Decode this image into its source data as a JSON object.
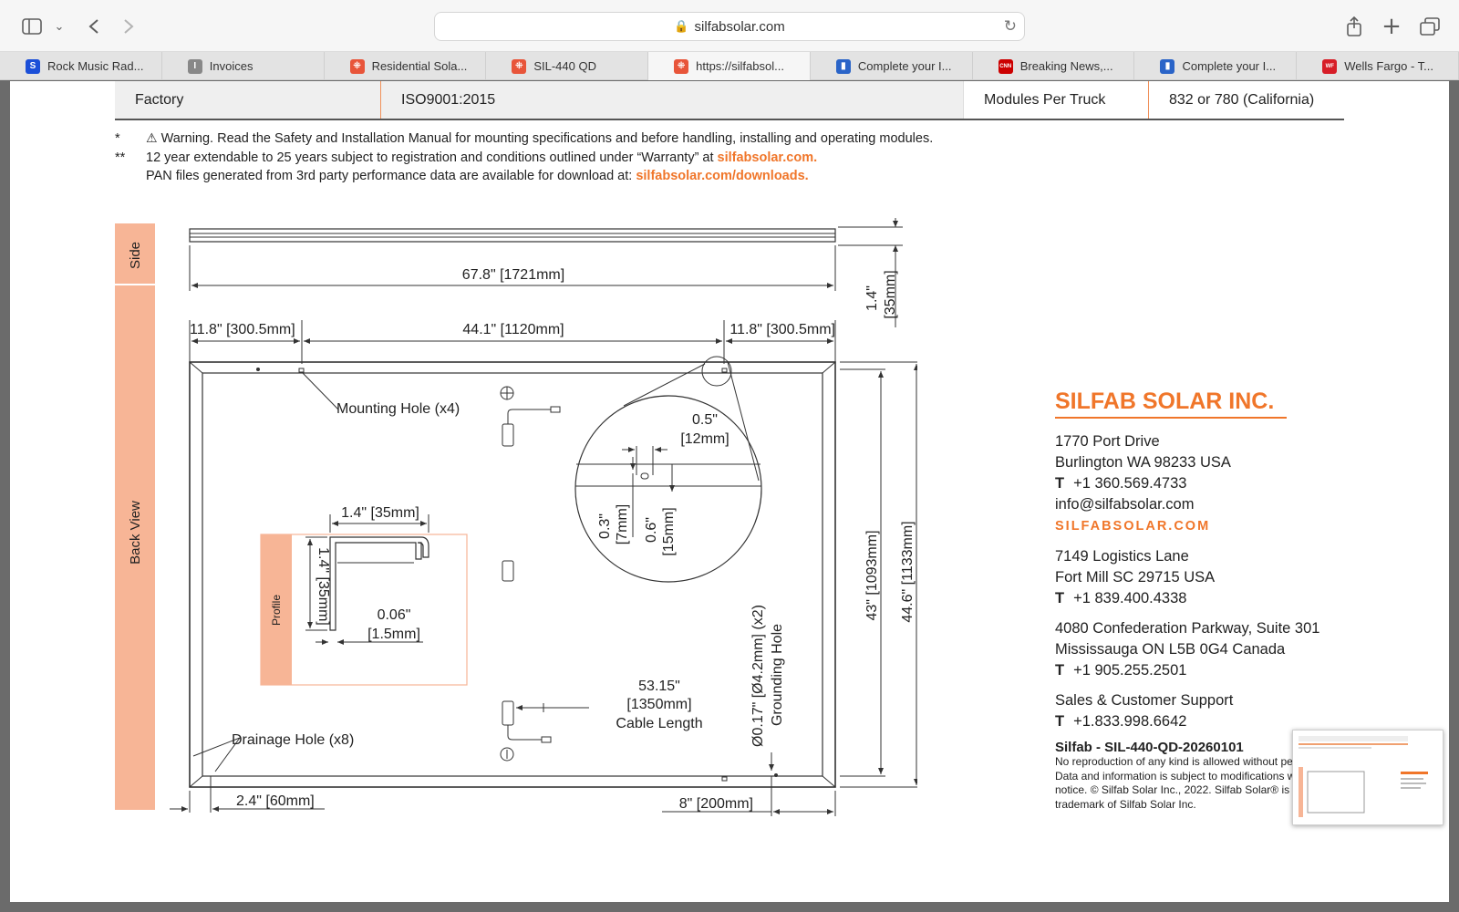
{
  "browser": {
    "url": "silfabsolar.com",
    "tabs": [
      {
        "label": "Rock Music Rad...",
        "favicon": "s-logo",
        "color": "#1b4fd8"
      },
      {
        "label": "Invoices",
        "favicon": "i-logo",
        "color": "#888888"
      },
      {
        "label": "Residential Sola...",
        "favicon": "silfab-logo",
        "color": "#e8553a"
      },
      {
        "label": "SIL-440 QD",
        "favicon": "silfab-logo",
        "color": "#e8553a"
      },
      {
        "label": "https://silfabsol...",
        "favicon": "silfab-logo",
        "color": "#e8553a"
      },
      {
        "label": "Complete your I...",
        "favicon": "tax-logo",
        "color": "#2a64c8"
      },
      {
        "label": "Breaking News,...",
        "favicon": "cnn-logo",
        "color": "#cc0000"
      },
      {
        "label": "Complete your I...",
        "favicon": "tax-logo",
        "color": "#2a64c8"
      },
      {
        "label": "Wells Fargo - T...",
        "favicon": "wellsfargo-logo",
        "color": "#d71e28"
      }
    ],
    "active_tab": 4
  },
  "spec": {
    "factory_label": "Factory",
    "factory_value": "ISO9001:2015",
    "truck_label": "Modules Per Truck",
    "truck_value": "832 or 780 (California)"
  },
  "notes": {
    "star1": "*",
    "warning_icon": "⚠",
    "warning_text": "Warning. Read the Safety and Installation Manual for mounting specifications and before handling, installing and operating modules.",
    "star2": "**",
    "warranty_text": "12 year extendable to 25 years subject to registration and conditions outlined under “Warranty” at ",
    "warranty_link": "silfabsolar.com.",
    "pan_text": "PAN files generated from 3rd party performance data are available for download at: ",
    "pan_link": "silfabsolar.com/downloads."
  },
  "drawing": {
    "side_label": "Side",
    "back_label": "Back View",
    "profile_label": "Profile",
    "length": "67.8\" [1721mm]",
    "thickness_in": "1.4\"",
    "thickness_mm": "[35mm]",
    "left_offset": "11.8\" [300.5mm]",
    "mid_span": "44.1\" [1120mm]",
    "right_offset": "11.8\" [300.5mm]",
    "mounting_hole": "Mounting Hole (x4)",
    "detail_w_in": "0.5\"",
    "detail_w_mm": "[12mm]",
    "detail_h1_in": "0.3\"",
    "detail_h1_mm": "[7mm]",
    "detail_h2_in": "0.6\"",
    "detail_h2_mm": "[15mm]",
    "profile_w": "1.4\" [35mm]",
    "profile_h": "1.4\" [35mm]",
    "profile_t_in": "0.06\"",
    "profile_t_mm": "[1.5mm]",
    "height_inner": "43\" [1093mm]",
    "height_outer": "44.6\" [1133mm]",
    "grounding_dim": "Ø0.17\" [Ø4.2mm] (x2)",
    "grounding_label": "Grounding Hole",
    "cable_in": "53.15\"",
    "cable_mm": "[1350mm]",
    "cable_label": "Cable Length",
    "drainage": "Drainage Hole (x8)",
    "bottom_left": "2.4\" [60mm]",
    "bottom_right": "8\" [200mm]",
    "accent": "#f7b596",
    "line": "#333333"
  },
  "company": {
    "name": "SILFAB SOLAR INC.",
    "addr1_l1": "1770 Port Drive",
    "addr1_l2": "Burlington WA 98233 USA",
    "addr1_phone": "+1 360.569.4733",
    "email": "info@silfabsolar.com",
    "web": "SILFABSOLAR.COM",
    "addr2_l1": "7149 Logistics Lane",
    "addr2_l2": "Fort Mill SC 29715 USA",
    "addr2_phone": "+1 839.400.4338",
    "addr3_l1": "4080 Confederation Parkway, Suite 301",
    "addr3_l2": "Mississauga ON L5B 0G4 Canada",
    "addr3_phone": "+1 905.255.2501",
    "support_label": "Sales & Customer Support",
    "support_phone": "+1.833.998.6642",
    "t": "T",
    "accent": "#f0762a"
  },
  "footer": {
    "doc_id": "Silfab - SIL-440-QD-20260101",
    "line1": "No reproduction of any kind is allowed without pe",
    "line2": "Data and information is subject to modifications w",
    "line3": "notice. © Silfab Solar Inc., 2022. Silfab Solar® is a r",
    "line4": "trademark of Silfab Solar Inc."
  }
}
